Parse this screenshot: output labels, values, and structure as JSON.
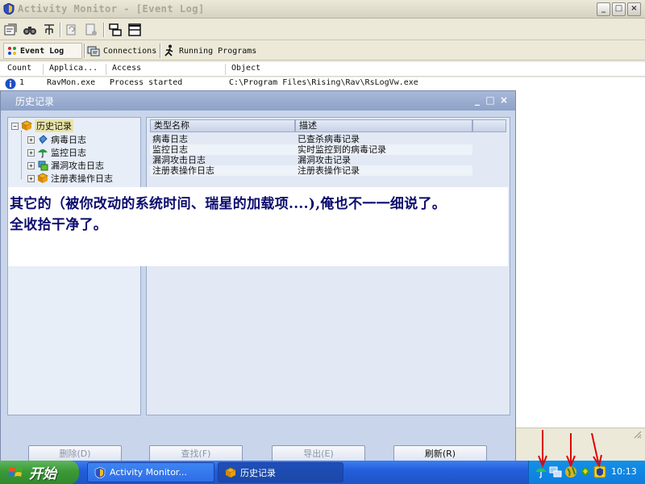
{
  "window": {
    "title": "Activity Monitor - [Event Log]",
    "controls": {
      "minimize": "_",
      "maximize": "□",
      "close": "×"
    }
  },
  "toolbar": {
    "icons": [
      "properties-icon",
      "find-icon",
      "filter-icon",
      "copy-icon",
      "clear-icon",
      "tile-icon",
      "split-icon"
    ]
  },
  "view_tabs": [
    {
      "label": "Event Log",
      "icon": "event-log-icon",
      "active": true
    },
    {
      "label": "Connections",
      "icon": "connections-icon",
      "active": false
    },
    {
      "label": "Running Programs",
      "icon": "running-programs-icon",
      "active": false
    }
  ],
  "log": {
    "columns": [
      "Count",
      "Applica...",
      "Access",
      "Object"
    ],
    "rows": [
      {
        "count": "1",
        "application": "RavMon.exe",
        "access": "Process started",
        "object": "C:\\Program Files\\Rising\\Rav\\RsLogVw.exe"
      }
    ]
  },
  "dialog": {
    "title": "历史记录",
    "controls": {
      "minimize": "_",
      "maximize": "□",
      "close": "×"
    },
    "tree": {
      "root": "历史记录",
      "children": [
        "病毒日志",
        "监控日志",
        "漏洞攻击日志",
        "注册表操作日志"
      ]
    },
    "list": {
      "columns": [
        "类型名称",
        "描述"
      ],
      "rows": [
        {
          "type": "病毒日志",
          "desc": "已查杀病毒记录"
        },
        {
          "type": "监控日志",
          "desc": "实时监控到的病毒记录"
        },
        {
          "type": "漏洞攻击日志",
          "desc": "漏洞攻击记录"
        },
        {
          "type": "注册表操作日志",
          "desc": "注册表操作记录"
        }
      ]
    },
    "buttons": {
      "delete": "删除(D)",
      "find": "查找(F)",
      "export": "导出(E)",
      "refresh": "刷新(R)"
    }
  },
  "annotation": {
    "line1": "其它的（被你改动的系统时间、瑞星的加载项....),俺也不一一细说了。",
    "line2": "全收拾干净了。"
  },
  "taskbar": {
    "start_label": "开始",
    "tasks": [
      {
        "label": "Activity Monitor...",
        "active": true
      },
      {
        "label": "历史记录",
        "active": false
      }
    ],
    "tray_icons": [
      "umbrella-icon",
      "network-icon",
      "globe-icon",
      "rising-icon",
      "shield-icon"
    ],
    "clock": "10:13"
  },
  "colors": {
    "taskbar_blue": "#245edb",
    "start_green": "#3b9a38",
    "annotation_text": "#0b0b6e",
    "arrow_red": "#e00000",
    "dialog_bg": "#c9d5ea"
  }
}
